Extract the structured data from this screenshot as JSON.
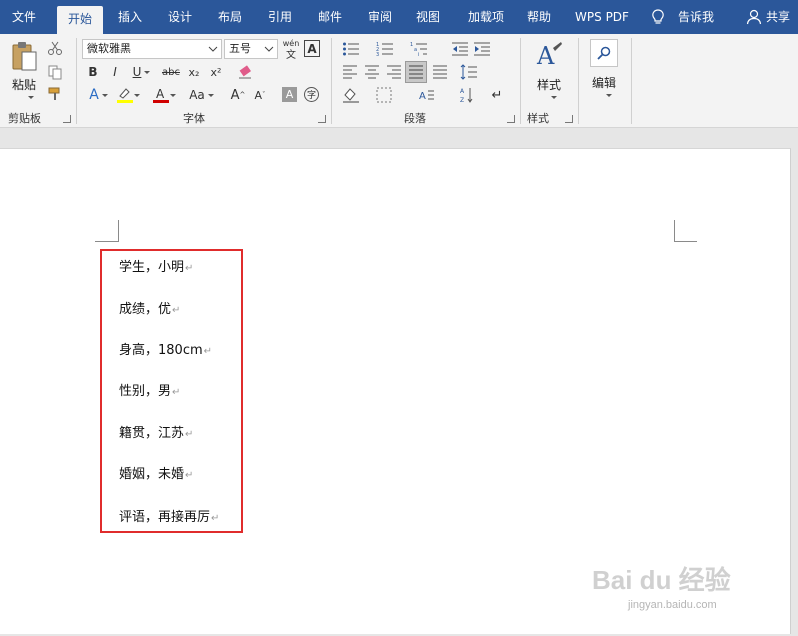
{
  "tabs": [
    {
      "label": "文件"
    },
    {
      "label": "开始"
    },
    {
      "label": "插入"
    },
    {
      "label": "设计"
    },
    {
      "label": "布局"
    },
    {
      "label": "引用"
    },
    {
      "label": "邮件"
    },
    {
      "label": "审阅"
    },
    {
      "label": "视图"
    },
    {
      "label": "加载项"
    },
    {
      "label": "帮助"
    },
    {
      "label": "WPS PDF"
    }
  ],
  "active_tab": "开始",
  "tell_me": "告诉我",
  "share": "共享",
  "ribbon": {
    "clipboard": {
      "paste": "粘贴",
      "label": "剪贴板"
    },
    "font": {
      "font_name": "微软雅黑",
      "font_size": "五号",
      "phonetic": "wén",
      "phonetic_char": "文",
      "label": "字体"
    },
    "paragraph": {
      "label": "段落"
    },
    "styles": {
      "button": "样式",
      "label": "样式"
    },
    "editing": {
      "button": "编辑"
    }
  },
  "document": {
    "lines": [
      "学生，小明",
      "成绩，优",
      "身高，180cm",
      "性别，男",
      "籍贯，江苏",
      "婚姻，未婚",
      "评语，再接再厉"
    ],
    "paragraph_mark": "↵"
  },
  "watermark": {
    "logo": "Bai du 经验",
    "url": "jingyan.baidu.com"
  },
  "colors": {
    "brand": "#2b579a",
    "highlight_box": "#e02c2c",
    "font_color_bar": "#d00000",
    "highlight_bar": "#ffff00"
  }
}
